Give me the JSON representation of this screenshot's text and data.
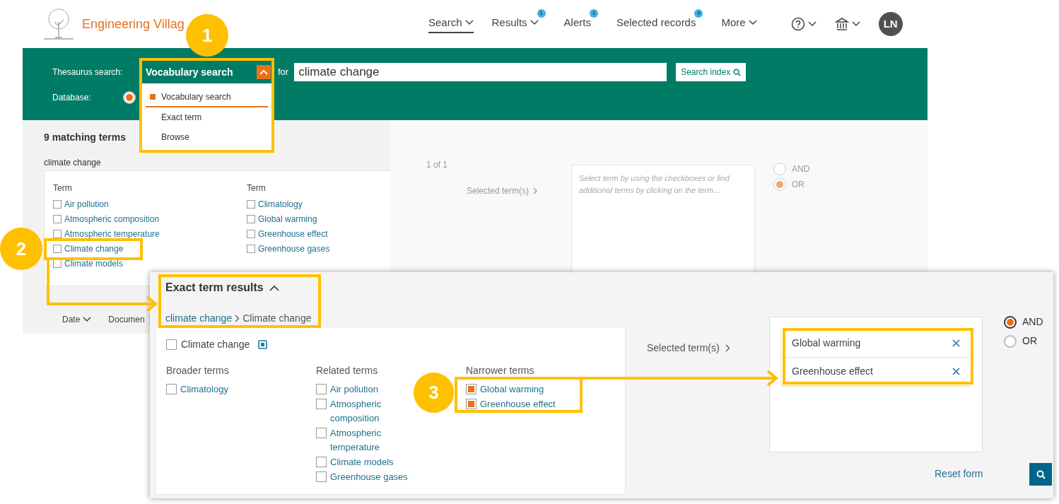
{
  "header": {
    "logo_text": "Engineering Villag",
    "nav": [
      {
        "label": "Search",
        "selected": true,
        "dropdown": true
      },
      {
        "label": "Results",
        "badge": "1",
        "selected": false,
        "dropdown": true
      },
      {
        "label": "Alerts",
        "badge": "1",
        "selected": false,
        "dropdown": false
      },
      {
        "label": "Selected records",
        "badge": "0",
        "selected": false,
        "dropdown": false
      },
      {
        "label": "More",
        "selected": false,
        "dropdown": true
      }
    ],
    "avatar": "LN"
  },
  "search_bar": {
    "label": "Thesaurus search:",
    "mode": "Vocabulary search",
    "for_label": "for",
    "query": "climate change",
    "button": "Search index",
    "database_label": "Database:",
    "database_radio": {
      "selected": true
    },
    "menu": [
      {
        "label": "Vocabulary search",
        "selected": true
      },
      {
        "label": "Exact term",
        "selected": false
      },
      {
        "label": "Browse",
        "selected": false
      }
    ]
  },
  "matches": {
    "title": "9 matching terms",
    "query": "climate change",
    "page": "1 of 1",
    "columns": [
      {
        "heading": "Term",
        "terms": [
          {
            "label": "Air pollution",
            "checked": false
          },
          {
            "label": "Atmospheric composition",
            "checked": false
          },
          {
            "label": "Atmospheric temperature",
            "checked": false
          },
          {
            "label": "Climate change",
            "checked": false
          },
          {
            "label": "Climate models",
            "checked": false
          }
        ]
      },
      {
        "heading": "Term",
        "terms": [
          {
            "label": "Climatology",
            "checked": false
          },
          {
            "label": "Global warming",
            "checked": false
          },
          {
            "label": "Greenhouse effect",
            "checked": false
          },
          {
            "label": "Greenhouse gases",
            "checked": false
          }
        ]
      }
    ],
    "selected_label": "Selected term(s)",
    "placeholder": "Select term by using the checkboxes or find additional terms by clicking on the term...",
    "combine": [
      {
        "label": "AND",
        "selected": false
      },
      {
        "label": "OR",
        "selected": true
      }
    ],
    "sort": [
      "Date",
      "Documen"
    ]
  },
  "exact_term": {
    "title": "Exact term results",
    "breadcrumb": {
      "link": "climate change",
      "current": "Climate change"
    },
    "term": {
      "label": "Climate change",
      "checked": false
    },
    "groups": [
      {
        "heading": "Broader terms",
        "terms": [
          {
            "label": "Climatology",
            "checked": false
          }
        ]
      },
      {
        "heading": "Related terms",
        "terms": [
          {
            "label": "Air pollution",
            "checked": false
          },
          {
            "label": "Atmospheric composition",
            "checked": false
          },
          {
            "label": "Atmospheric temperature",
            "checked": false
          },
          {
            "label": "Climate models",
            "checked": false
          },
          {
            "label": "Greenhouse gases",
            "checked": false
          }
        ]
      },
      {
        "heading": "Narrower terms",
        "terms": [
          {
            "label": "Global warming",
            "checked": true
          },
          {
            "label": "Greenhouse effect",
            "checked": true
          }
        ]
      }
    ],
    "selected_label": "Selected term(s)",
    "selected_terms": [
      "Global warming",
      "Greenhouse effect"
    ],
    "combine": [
      {
        "label": "AND",
        "selected": true
      },
      {
        "label": "OR",
        "selected": false
      }
    ],
    "reset": "Reset form"
  },
  "callouts": [
    "1",
    "2",
    "3"
  ]
}
